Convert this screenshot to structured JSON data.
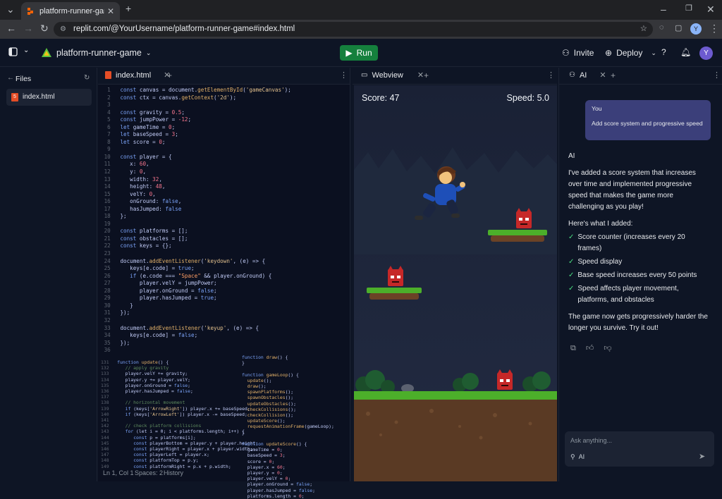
{
  "browser": {
    "tab_title": "platform-runner-game - Replit",
    "url": "replit.com/@YourUsername/platform-runner-game#index.html",
    "profile_initial": "Y"
  },
  "header": {
    "project_name": "platform-runner-game",
    "run_label": "Run",
    "invite_label": "Invite",
    "deploy_label": "Deploy",
    "avatar_initial": "Y"
  },
  "files": {
    "title": "Files",
    "items": [
      "index.html"
    ]
  },
  "editor": {
    "tab": "index.html",
    "status": {
      "position": "Ln 1, Col 1",
      "spaces": "Spaces: 2",
      "history": "History"
    }
  },
  "webview": {
    "tab": "Webview",
    "score_label": "Score: 47",
    "speed_label": "Speed: 5.0"
  },
  "ai": {
    "tab": "AI",
    "user_label": "You",
    "user_message": "Add score system and progressive speed",
    "ai_label": "AI",
    "intro": "I've added a score system that increases over time and implemented progressive speed that makes the game more challenging as you play!",
    "list_title": "Here's what I added:",
    "items": [
      "Score counter (increases every 20 frames)",
      "Speed display",
      "Base speed increases every 50 points",
      "Speed affects player movement, platforms, and obstacles"
    ],
    "outro": "The game now gets progressively harder the longer you survive. Try it out!",
    "input_placeholder": "Ask anything...",
    "input_mode": "AI"
  },
  "colors": {
    "run": "#15803d",
    "bubble": "#3b3f7a",
    "check": "#4ade80",
    "grass": "#4caf2a",
    "enemy": "#c62828"
  }
}
